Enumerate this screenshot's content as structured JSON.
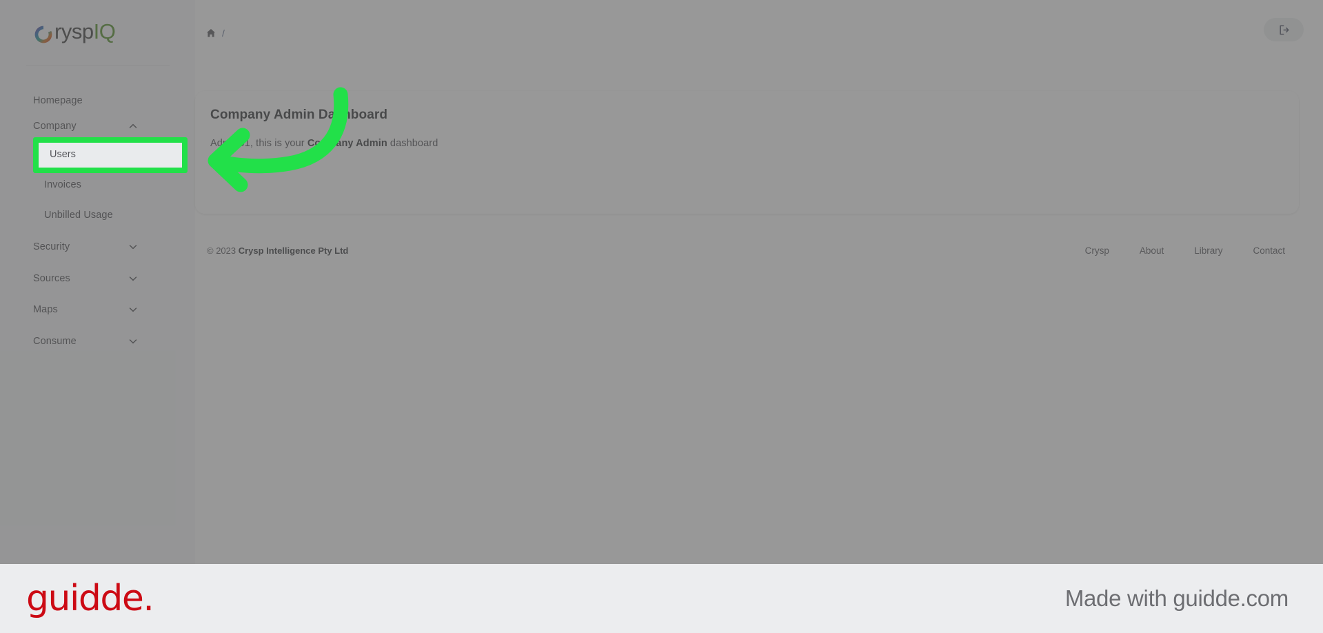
{
  "brand": {
    "logo_prefix": "C",
    "logo_middle": "rysp",
    "logo_suffix": "IQ",
    "logo_suffix_color": "#4f8f22"
  },
  "header": {
    "breadcrumb_home_icon": "home-icon",
    "breadcrumb_separator": "/",
    "logout_icon": "logout-icon"
  },
  "sidebar": {
    "items": [
      {
        "label": "Homepage",
        "level": "top",
        "expandable": false,
        "state": "default"
      },
      {
        "label": "Company",
        "level": "top",
        "expandable": true,
        "state": "expanded",
        "chevron": "chevron-up-icon"
      },
      {
        "label": "Users",
        "level": "sub",
        "expandable": false,
        "state": "active"
      },
      {
        "label": "Invoices",
        "level": "sub",
        "expandable": false,
        "state": "default"
      },
      {
        "label": "Unbilled Usage",
        "level": "sub",
        "expandable": false,
        "state": "default"
      },
      {
        "label": "Security",
        "level": "top",
        "expandable": true,
        "state": "collapsed",
        "chevron": "chevron-down-icon"
      },
      {
        "label": "Sources",
        "level": "top",
        "expandable": true,
        "state": "collapsed",
        "chevron": "chevron-down-icon"
      },
      {
        "label": "Maps",
        "level": "top",
        "expandable": true,
        "state": "collapsed",
        "chevron": "chevron-down-icon"
      },
      {
        "label": "Consume",
        "level": "top",
        "expandable": true,
        "state": "collapsed",
        "chevron": "chevron-down-icon"
      }
    ]
  },
  "main": {
    "card_title": "Company Admin Dashboard",
    "card_subtitle_prefix": "Admin01, this is your ",
    "card_subtitle_bold": "Company Admin",
    "card_subtitle_suffix": " dashboard"
  },
  "footer": {
    "copyright_prefix": "© 2023 ",
    "copyright_company": "Crysp Intelligence Pty Ltd",
    "links": [
      {
        "label": "Crysp"
      },
      {
        "label": "About"
      },
      {
        "label": "Library"
      },
      {
        "label": "Contact"
      }
    ]
  },
  "annotation": {
    "highlight_target_label": "Users",
    "highlight_color": "#22e049",
    "arrow_color": "#22e049",
    "arrow_icon": "curved-arrow-left-icon"
  },
  "guidde": {
    "logo_text": "guidde.",
    "logo_color": "#cc0a14",
    "made_with_text": "Made with guidde.com",
    "banner_bg": "#ecedef"
  }
}
